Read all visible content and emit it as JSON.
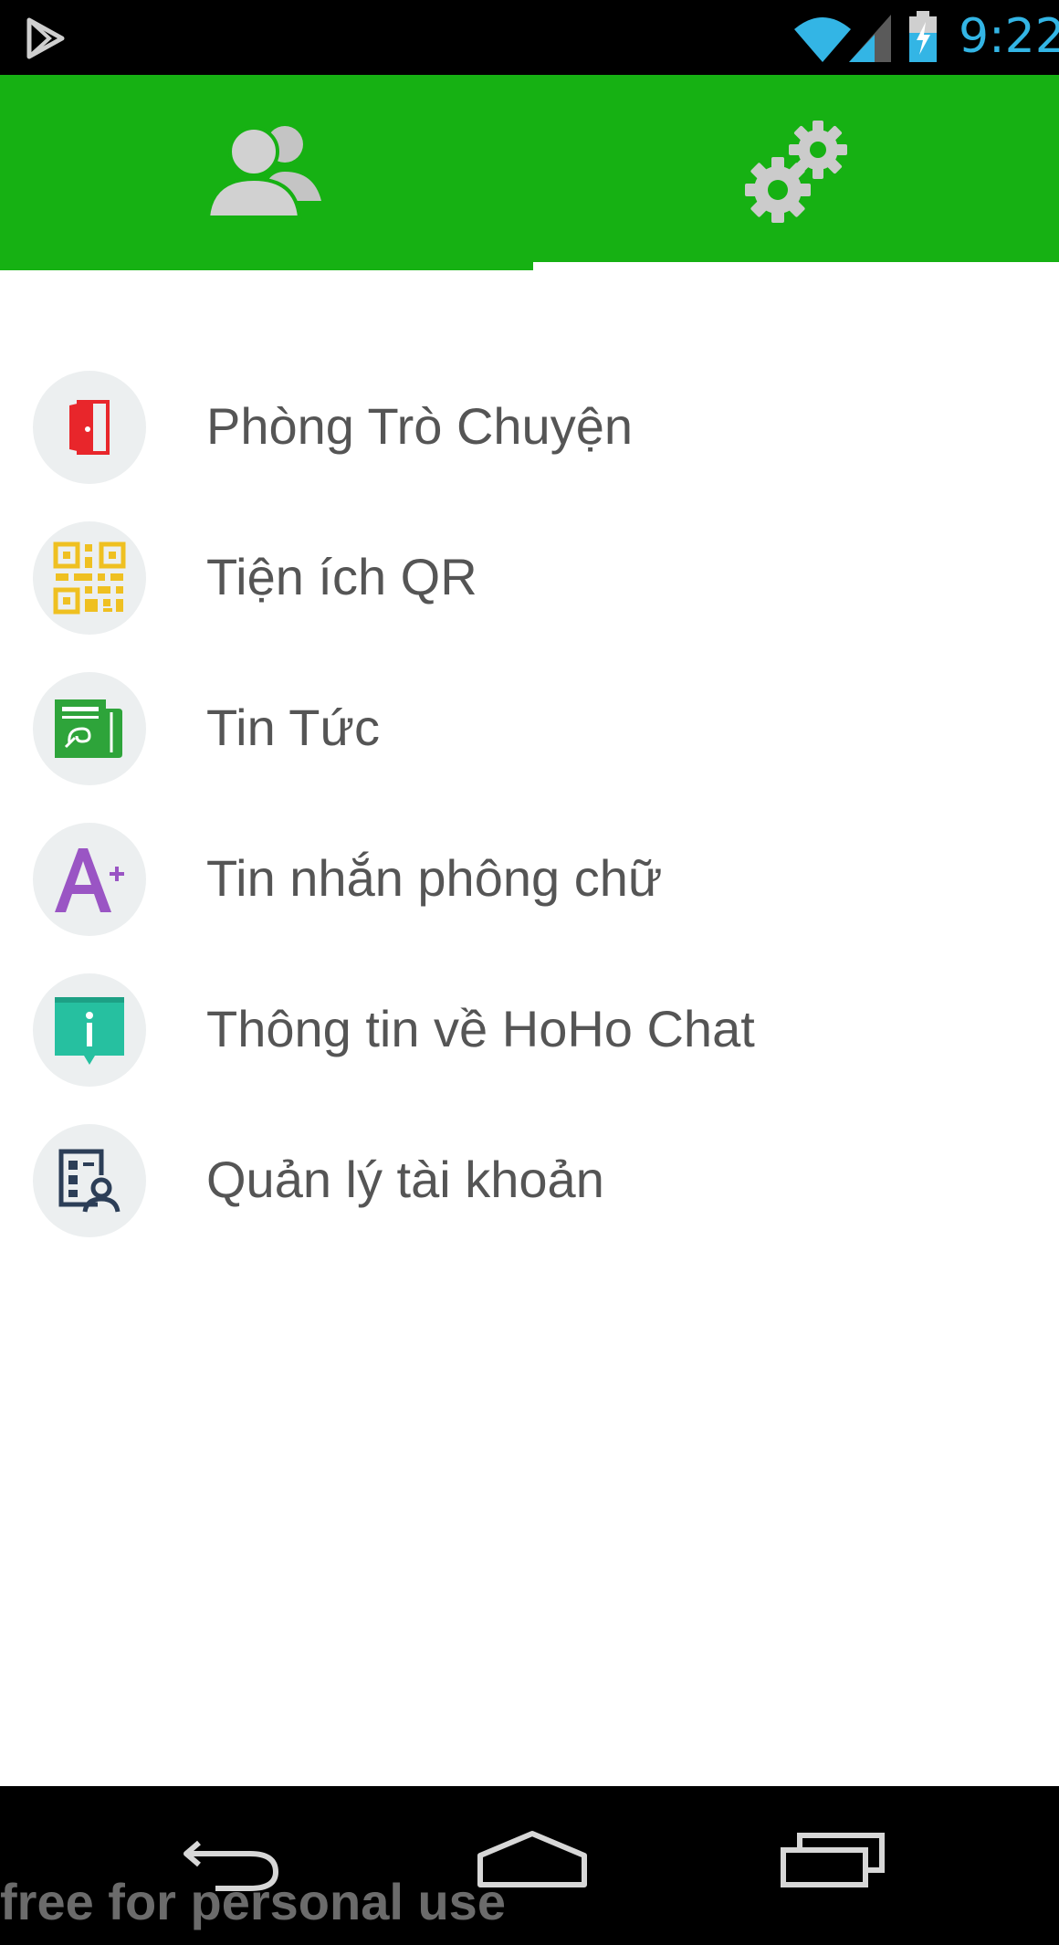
{
  "status_bar": {
    "time": "9:22",
    "icons": [
      "play-store-icon",
      "wifi-icon",
      "signal-icon",
      "battery-charging-icon"
    ]
  },
  "tabs": [
    {
      "icon": "contacts-icon",
      "selected": false
    },
    {
      "icon": "settings-gears-icon",
      "selected": true
    }
  ],
  "menu": {
    "items": [
      {
        "label": "Phòng Trò Chuyện",
        "icon": "door-icon",
        "color": "#e8262b"
      },
      {
        "label": "Tiện ích QR",
        "icon": "qr-code-icon",
        "color": "#efc021"
      },
      {
        "label": "Tin Tức",
        "icon": "newspaper-icon",
        "color": "#2ea43a"
      },
      {
        "label": "Tin nhắn phông chữ",
        "icon": "font-plus-icon",
        "color": "#9a55c4"
      },
      {
        "label": "Thông tin về HoHo Chat",
        "icon": "info-icon",
        "color": "#26c0a0"
      },
      {
        "label": "Quản lý tài khoản",
        "icon": "account-management-icon",
        "color": "#2c3e57"
      }
    ]
  },
  "nav_bar": {
    "buttons": [
      "back-icon",
      "home-icon",
      "recents-icon"
    ]
  },
  "watermark": "free for personal use",
  "colors": {
    "header": "#16b113",
    "status_bar": "#000000",
    "clock": "#33b5e5",
    "label_text": "#555555",
    "icon_bg": "#eceff0"
  }
}
